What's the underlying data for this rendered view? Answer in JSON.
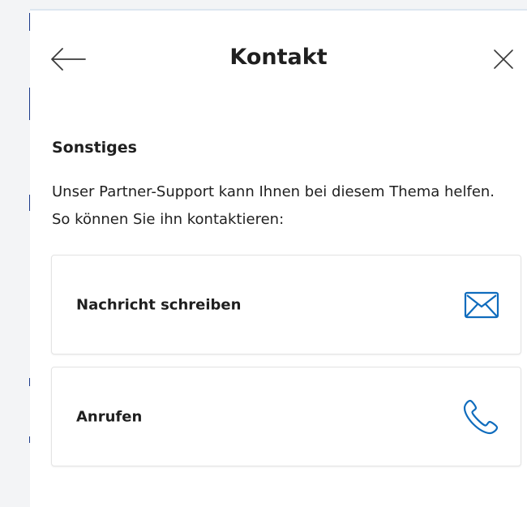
{
  "header": {
    "title": "Kontakt",
    "back_icon": "arrow-left-icon",
    "close_icon": "close-icon"
  },
  "section": {
    "heading": "Sonstiges",
    "text": "Unser Partner-Support kann Ihnen bei diesem Thema helfen. So können Sie ihn kontaktieren:"
  },
  "options": [
    {
      "label": "Nachricht schreiben",
      "icon": "envelope-icon"
    },
    {
      "label": "Anrufen",
      "icon": "phone-icon"
    }
  ],
  "colors": {
    "accent": "#0f6cbd",
    "text": "#1f1f1f",
    "card_border": "#e3e3e3"
  }
}
